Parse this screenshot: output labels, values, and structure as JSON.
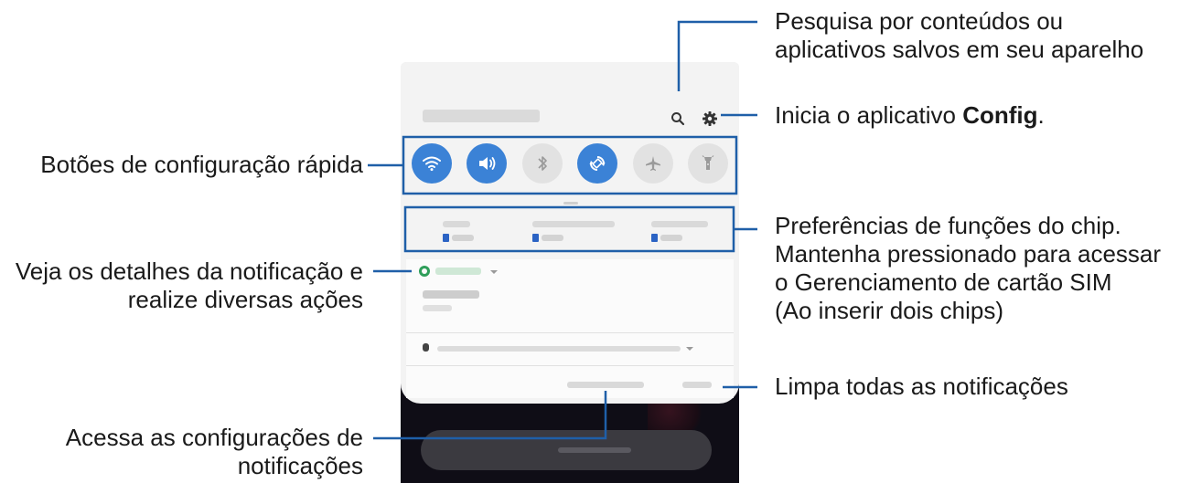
{
  "callouts": {
    "search": {
      "line1": "Pesquisa por conteúdos ou",
      "line2": "aplicativos salvos em seu aparelho"
    },
    "settings": {
      "prefix": "Inicia o aplicativo ",
      "bold": "Config",
      "suffix": "."
    },
    "quick_buttons": "Botões de configuração rápida",
    "sim": {
      "line1": "Preferências de funções do chip.",
      "line2": "Mantenha pressionado para acessar",
      "line3": "o Gerenciamento de cartão SIM",
      "line4": "(Ao inserir dois chips)"
    },
    "notification": {
      "line1": "Veja os detalhes da notificação e",
      "line2": "realize diversas ações"
    },
    "clear": "Limpa todas as notificações",
    "notif_settings": {
      "line1": "Acessa as configurações de",
      "line2": "notificações"
    }
  },
  "quick_buttons": [
    {
      "name": "wifi",
      "on": true
    },
    {
      "name": "sound",
      "on": true
    },
    {
      "name": "bluetooth",
      "on": false
    },
    {
      "name": "auto-rotate",
      "on": true
    },
    {
      "name": "airplane",
      "on": false
    },
    {
      "name": "flashlight",
      "on": false
    }
  ],
  "icons": {
    "search": "search-icon",
    "settings": "gear-icon"
  },
  "colors": {
    "accent_blue": "#3b82d6",
    "callout_line": "#1f5fa8",
    "panel_bg": "#ececec"
  }
}
